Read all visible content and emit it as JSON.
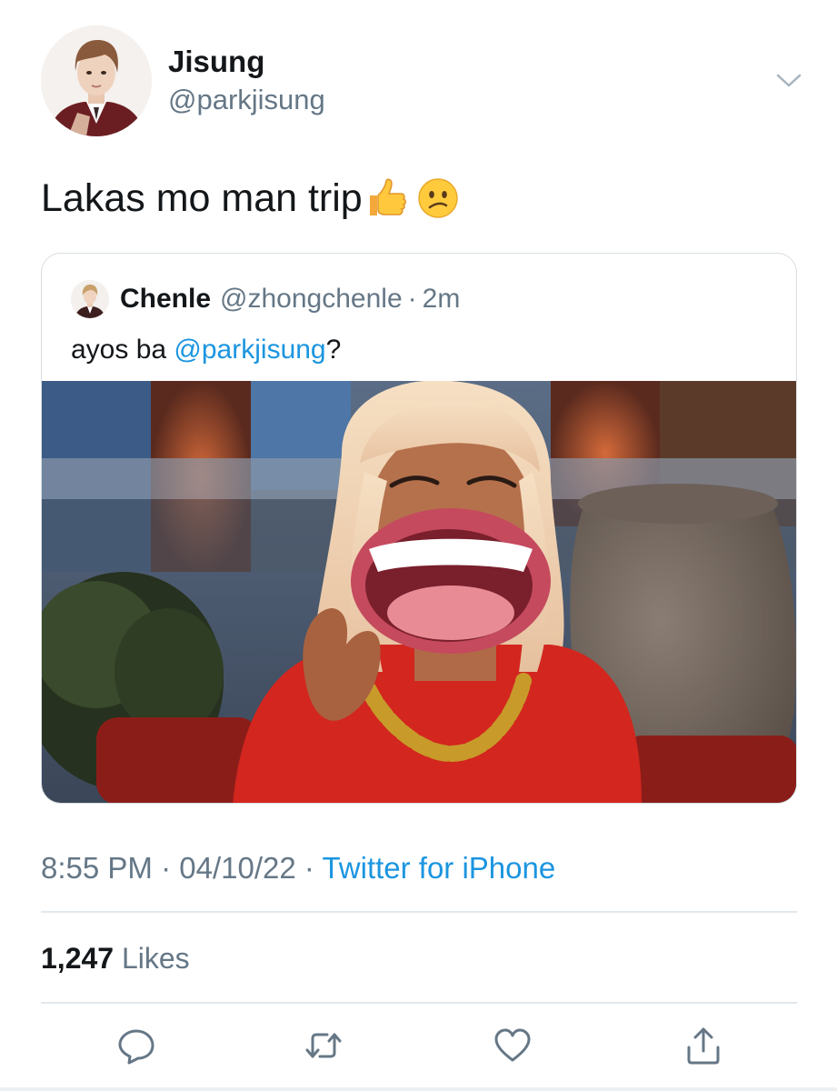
{
  "author": {
    "display_name": "Jisung",
    "handle": "@parkjisung"
  },
  "tweet": {
    "text": "Lakas mo man trip",
    "emojis": [
      "thumbs-up",
      "confused-face"
    ]
  },
  "quoted_tweet": {
    "display_name": "Chenle",
    "handle": "@zhongchenle",
    "separator": "·",
    "time": "2m",
    "text_before": "ayos ba ",
    "mention": "@parkjisung",
    "text_after": "?"
  },
  "meta": {
    "time": "8:55 PM",
    "separator": " · ",
    "date": "04/10/22",
    "source": "Twitter for iPhone"
  },
  "stats": {
    "likes_count": "1,247",
    "likes_label": "Likes"
  },
  "actions": [
    "reply-icon",
    "retweet-icon",
    "like-icon",
    "share-icon"
  ],
  "colors": {
    "link": "#1b95e0",
    "secondary": "#657786",
    "primary": "#14171a",
    "border": "#e1e8ed"
  }
}
